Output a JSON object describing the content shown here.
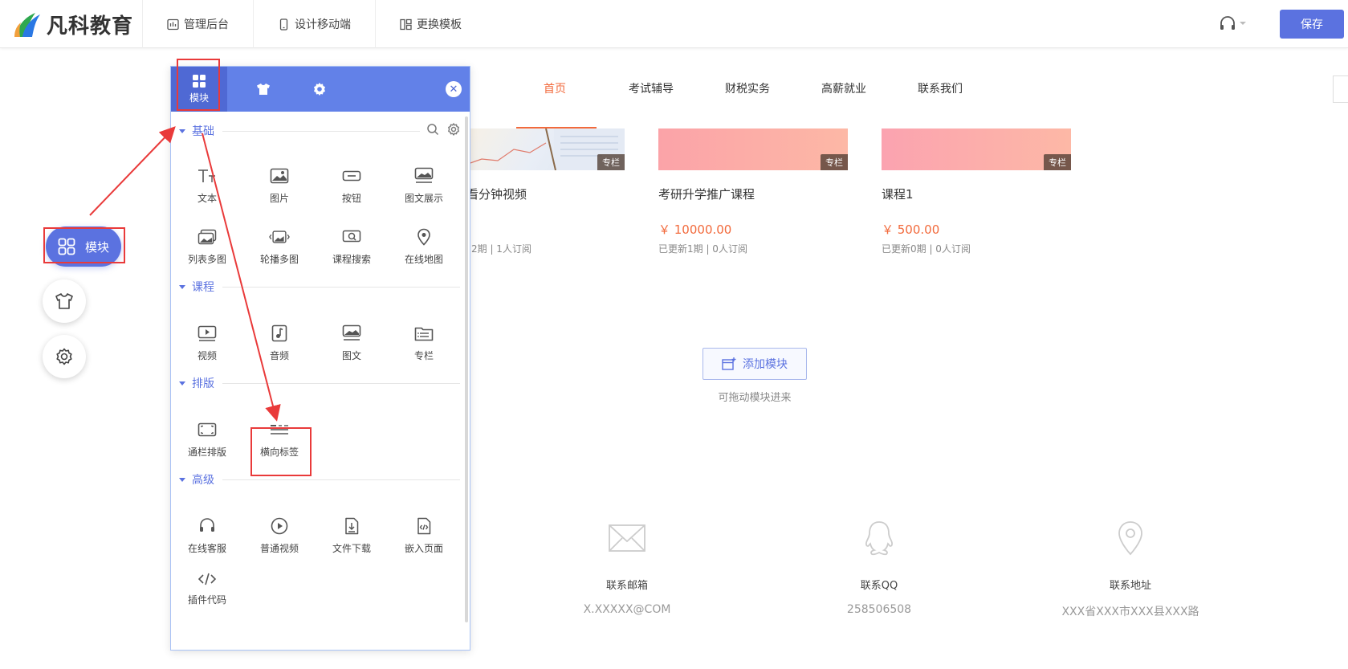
{
  "topbar": {
    "brand": "凡科教育",
    "nav": [
      {
        "label": "管理后台",
        "icon": "chart-icon"
      },
      {
        "label": "设计移动端",
        "icon": "mobile-icon"
      },
      {
        "label": "更换模板",
        "icon": "template-icon"
      }
    ],
    "save_label": "保存",
    "support_icon": "headset-icon"
  },
  "float_toolbar": {
    "module_label": "模块",
    "theme_icon": "shirt-icon",
    "settings_icon": "gear-icon"
  },
  "panel": {
    "tabs": [
      {
        "label": "模块",
        "icon": "grid-icon"
      },
      {
        "label": "",
        "icon": "shirt-icon"
      },
      {
        "label": "",
        "icon": "gear-icon"
      }
    ],
    "close_icon": "close-icon",
    "sections": [
      {
        "title": "基础",
        "items": [
          {
            "label": "文本",
            "icon": "text-icon"
          },
          {
            "label": "图片",
            "icon": "image-icon"
          },
          {
            "label": "按钮",
            "icon": "button-icon"
          },
          {
            "label": "图文展示",
            "icon": "image-text-icon"
          },
          {
            "label": "列表多图",
            "icon": "gallery-icon"
          },
          {
            "label": "轮播多图",
            "icon": "carousel-icon"
          },
          {
            "label": "课程搜索",
            "icon": "course-search-icon"
          },
          {
            "label": "在线地图",
            "icon": "map-pin-icon"
          }
        ]
      },
      {
        "title": "课程",
        "items": [
          {
            "label": "视频",
            "icon": "video-icon"
          },
          {
            "label": "音频",
            "icon": "audio-icon"
          },
          {
            "label": "图文",
            "icon": "article-icon"
          },
          {
            "label": "专栏",
            "icon": "column-icon"
          }
        ]
      },
      {
        "title": "排版",
        "items": [
          {
            "label": "通栏排版",
            "icon": "fullwidth-icon"
          },
          {
            "label": "横向标签",
            "icon": "horizontal-tabs-icon"
          }
        ]
      },
      {
        "title": "高级",
        "items": [
          {
            "label": "在线客服",
            "icon": "headset-icon"
          },
          {
            "label": "普通视频",
            "icon": "play-circle-icon"
          },
          {
            "label": "文件下载",
            "icon": "download-icon"
          },
          {
            "label": "嵌入页面",
            "icon": "embed-icon"
          },
          {
            "label": "插件代码",
            "icon": "code-icon"
          }
        ]
      }
    ]
  },
  "site_nav": [
    "首页",
    "考试辅导",
    "财税实务",
    "高薪就业",
    "联系我们"
  ],
  "courses": [
    {
      "title": "试看分钟视频",
      "price": "",
      "meta": "2期  |  1人订阅",
      "tag": "专栏"
    },
    {
      "title": "考研升学推广课程",
      "price": "￥ 10000.00",
      "meta": "已更新1期  |  0人订阅",
      "tag": "专栏"
    },
    {
      "title": "课程1",
      "price": "￥ 500.00",
      "meta": "已更新0期  |  0人订阅",
      "tag": "专栏"
    }
  ],
  "add_module": {
    "label": "添加模块",
    "hint": "可拖动模块进来"
  },
  "contacts": [
    {
      "label": "联系邮箱",
      "value": "X.XXXXX@COM",
      "icon": "mail-icon"
    },
    {
      "label": "联系QQ",
      "value": "258506508",
      "icon": "qq-icon"
    },
    {
      "label": "联系地址",
      "value": "XXX省XXX市XXX县XXX路",
      "icon": "location-icon"
    }
  ],
  "colors": {
    "accent": "#5b72e0",
    "panel_header": "#6281e8",
    "price": "#f26a3c",
    "annotation": "#e93a3a"
  }
}
